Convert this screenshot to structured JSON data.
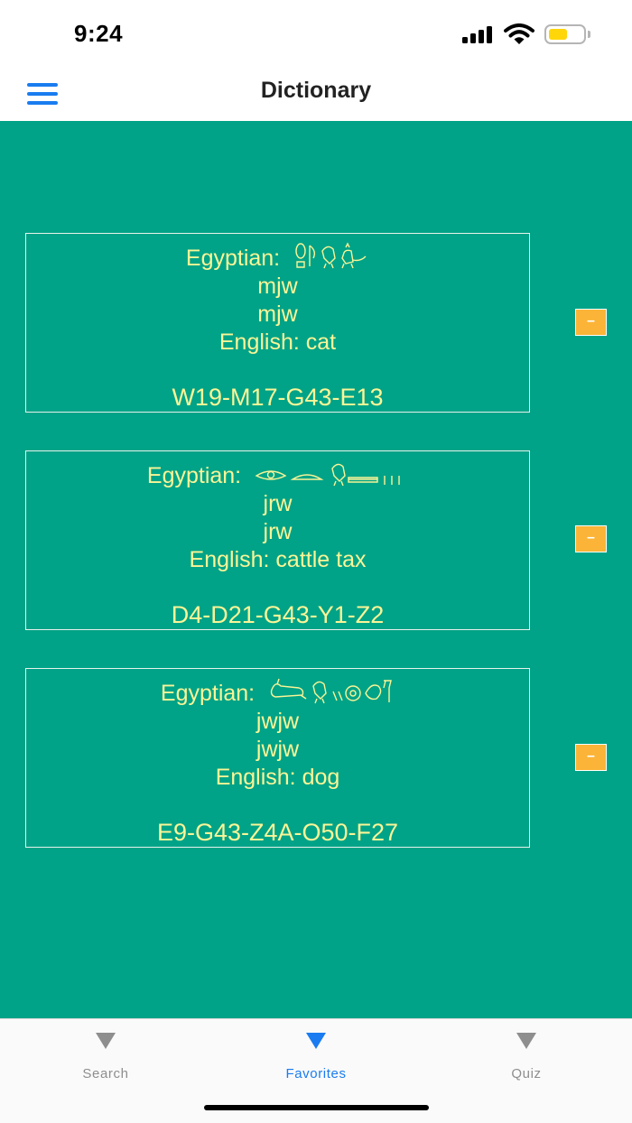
{
  "status": {
    "time": "9:24"
  },
  "nav": {
    "title": "Dictionary",
    "menu_icon": "hamburger-menu-icon"
  },
  "colors": {
    "accent": "#1a7cf0",
    "content_background": "#00a387",
    "card_text": "#fbf597",
    "remove_button": "#fbb437",
    "battery": "#ffd60a"
  },
  "favorites": [
    {
      "egyptian_label": "Egyptian:",
      "transliteration_1": "mjw",
      "transliteration_2": "mjw",
      "english": "English: cat",
      "code": "W19-M17-G43-E13",
      "remove_label": "–"
    },
    {
      "egyptian_label": "Egyptian:",
      "transliteration_1": "jrw",
      "transliteration_2": "jrw",
      "english": "English: cattle tax",
      "code": "D4-D21-G43-Y1-Z2",
      "remove_label": "–"
    },
    {
      "egyptian_label": "Egyptian:",
      "transliteration_1": "jwjw",
      "transliteration_2": "jwjw",
      "english": "English: dog",
      "code": "E9-G43-Z4A-O50-F27",
      "remove_label": "–"
    }
  ],
  "tabs": [
    {
      "label": "Search",
      "icon": "triangle-down-icon",
      "active": false
    },
    {
      "label": "Favorites",
      "icon": "triangle-down-icon",
      "active": true
    },
    {
      "label": "Quiz",
      "icon": "triangle-down-icon",
      "active": false
    }
  ]
}
